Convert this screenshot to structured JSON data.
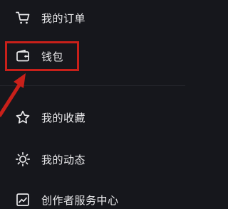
{
  "menu": {
    "items": [
      {
        "label": "我的订单",
        "icon": "cart-icon"
      },
      {
        "label": "钱包",
        "icon": "wallet-icon"
      },
      {
        "label": "我的收藏",
        "icon": "star-icon"
      },
      {
        "label": "我的动态",
        "icon": "sun-icon"
      },
      {
        "label": "创作者服务中心",
        "icon": "trend-chart-icon"
      }
    ]
  },
  "annotation": {
    "highlight_target": "钱包",
    "highlight_color": "#c8201a",
    "arrow_color": "#c8201a"
  },
  "colors": {
    "background": "#16171c",
    "text": "#e8e8ea",
    "icon": "#e8e8ea"
  }
}
